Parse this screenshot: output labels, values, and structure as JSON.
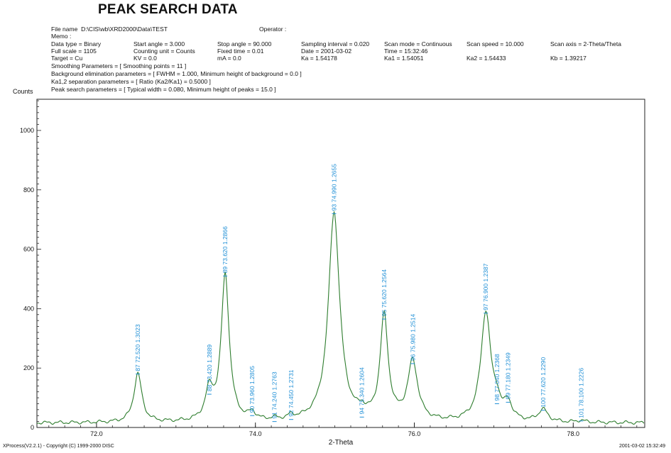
{
  "header": {
    "title": "PEAK SEARCH DATA",
    "file_name_label": "File name",
    "file_name": "D:\\CIS\\wb\\XRD2000\\Data\\TEST",
    "operator": "Operator :",
    "memo": "Memo :",
    "rows": [
      [
        "Data type = Binary",
        "Start angle = 3.000",
        "Stop angle = 90.000",
        "Sampling interval = 0.020",
        "Scan mode = Continuous",
        "Scan speed = 10.000",
        "Scan axis = 2-Theta/Theta"
      ],
      [
        "Full scale = 1105",
        "Counting unit = Counts",
        "Fixed time = 0.01",
        "Date = 2001-03-02",
        "Time = 15:32:46",
        "",
        ""
      ],
      [
        "Target = Cu",
        "KV = 0.0",
        "mA = 0.0",
        "Ka = 1.54178",
        "Ka1 = 1.54051",
        "Ka2 = 1.54433",
        "Kb = 1.39217"
      ]
    ],
    "smoothing": "Smoothing Parameters = [ Smoothing points = 11 ]",
    "background": "Background elimination parameters = [ FWHM = 1.000,  Minimum height of background = 0.0 ]",
    "ka_sep": "Ka1,2 separation parameters = [ Ratio (Ka2/Ka1) = 0.5000 ]",
    "peak_search": "Peak search parameters = [ Typical width = 0.080,  Minimum height of peaks = 15.0 ]"
  },
  "footer": {
    "left": "XProcess(V2.2.1) - Copyright (C) 1999-2000 DISC",
    "right": "2001-03-02  15:32:49"
  },
  "chart_data": {
    "type": "line",
    "title": "PEAK SEARCH DATA",
    "xlabel": "2-Theta",
    "ylabel": "Counts",
    "xlim": [
      71.25,
      78.9
    ],
    "ylim": [
      0,
      1105
    ],
    "x_ticks": [
      72.0,
      74.0,
      76.0,
      78.0
    ],
    "x_tick_labels": [
      "72.0",
      "74.0",
      "76.0",
      "78.0"
    ],
    "y_ticks": [
      0,
      200,
      400,
      600,
      800,
      1000
    ],
    "y_tick_labels": [
      "0",
      "200",
      "400",
      "600",
      "800",
      "1000"
    ],
    "line_color": "#2e7d2e",
    "label_color": "#1f8fd6",
    "baseline": 15,
    "peak_profile": [
      {
        "x": 72.52,
        "h": 165,
        "w": 0.06
      },
      {
        "x": 73.42,
        "h": 98,
        "w": 0.06
      },
      {
        "x": 73.62,
        "h": 495,
        "w": 0.06
      },
      {
        "x": 73.96,
        "h": 25,
        "w": 0.05
      },
      {
        "x": 74.24,
        "h": 6,
        "w": 0.05
      },
      {
        "x": 74.45,
        "h": 12,
        "w": 0.05
      },
      {
        "x": 74.99,
        "h": 705,
        "w": 0.085
      },
      {
        "x": 75.34,
        "h": 20,
        "w": 0.05
      },
      {
        "x": 75.62,
        "h": 350,
        "w": 0.06
      },
      {
        "x": 75.98,
        "h": 200,
        "w": 0.075
      },
      {
        "x": 76.9,
        "h": 370,
        "w": 0.075
      },
      {
        "x": 77.04,
        "h": 45,
        "w": 0.05
      },
      {
        "x": 77.18,
        "h": 55,
        "w": 0.06
      },
      {
        "x": 77.62,
        "h": 42,
        "w": 0.07
      },
      {
        "x": 78.1,
        "h": 7,
        "w": 0.05
      }
    ],
    "peaks": [
      {
        "x": 72.52,
        "y": 180,
        "label": "87  72.520  1.3023"
      },
      {
        "x": 73.42,
        "y": 112,
        "label": "88  73.420  1.2889"
      },
      {
        "x": 73.62,
        "y": 510,
        "label": "89  73.620  1.2866"
      },
      {
        "x": 73.96,
        "y": 40,
        "label": "90  73.960  1.2805"
      },
      {
        "x": 74.24,
        "y": 20,
        "label": "91  74.240  1.2763"
      },
      {
        "x": 74.45,
        "y": 27,
        "label": "92  74.450  1.2731"
      },
      {
        "x": 74.99,
        "y": 720,
        "label": "93  74.990  1.2655"
      },
      {
        "x": 75.34,
        "y": 35,
        "label": "94  75.340  1.2604"
      },
      {
        "x": 75.62,
        "y": 365,
        "label": "95  75.620  1.2564"
      },
      {
        "x": 75.98,
        "y": 215,
        "label": "96  75.980  1.2514"
      },
      {
        "x": 76.9,
        "y": 385,
        "label": "97  76.900  1.2387"
      },
      {
        "x": 77.04,
        "y": 80,
        "label": "98  77.040  1.2368"
      },
      {
        "x": 77.18,
        "y": 85,
        "label": "99  77.180  1.2349"
      },
      {
        "x": 77.62,
        "y": 58,
        "label": "100  77.620  1.2290"
      },
      {
        "x": 78.1,
        "y": 22,
        "label": "101  78.100  1.2226"
      }
    ]
  }
}
